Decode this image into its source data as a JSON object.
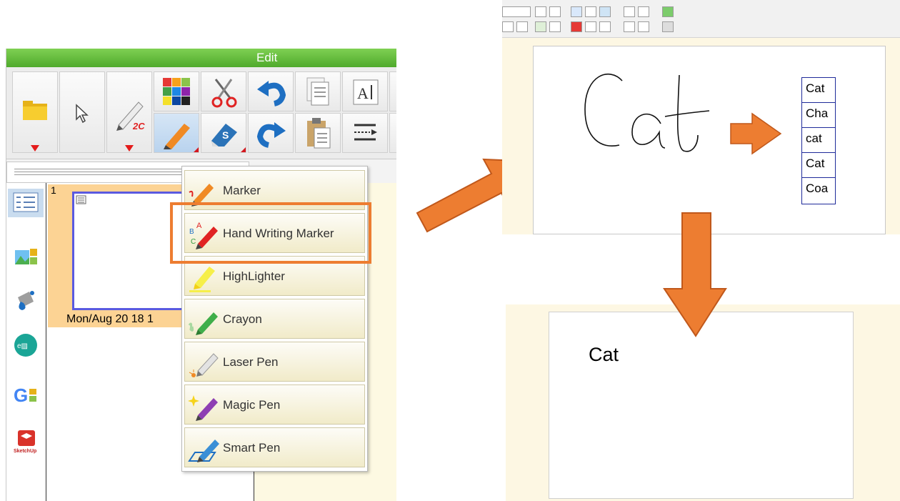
{
  "app": {
    "edit_title": "Edit",
    "thumbnail": {
      "number": "1",
      "date": "Mon/Aug 20 18 1"
    }
  },
  "pen_menu": {
    "items": [
      {
        "label": "Marker",
        "icon": "marker-icon"
      },
      {
        "label": "Hand Writing Marker",
        "icon": "handwriting-marker-icon"
      },
      {
        "label": "HighLighter",
        "icon": "highlighter-icon"
      },
      {
        "label": "Crayon",
        "icon": "crayon-icon"
      },
      {
        "label": "Laser Pen",
        "icon": "laser-pen-icon"
      },
      {
        "label": "Magic Pen",
        "icon": "magic-pen-icon"
      },
      {
        "label": "Smart Pen",
        "icon": "smart-pen-icon"
      }
    ],
    "highlighted_item": "Hand Writing Marker"
  },
  "recognition": {
    "candidates": [
      "Cat",
      "Cha",
      "cat",
      "Cat",
      "Coa"
    ]
  },
  "result": {
    "text": "Cat"
  },
  "colors": {
    "accent_green": "#4faa2c",
    "highlight_orange": "#ed7d31",
    "candidate_border": "#1f2b9a",
    "page_yellow": "#fdf7e3"
  }
}
